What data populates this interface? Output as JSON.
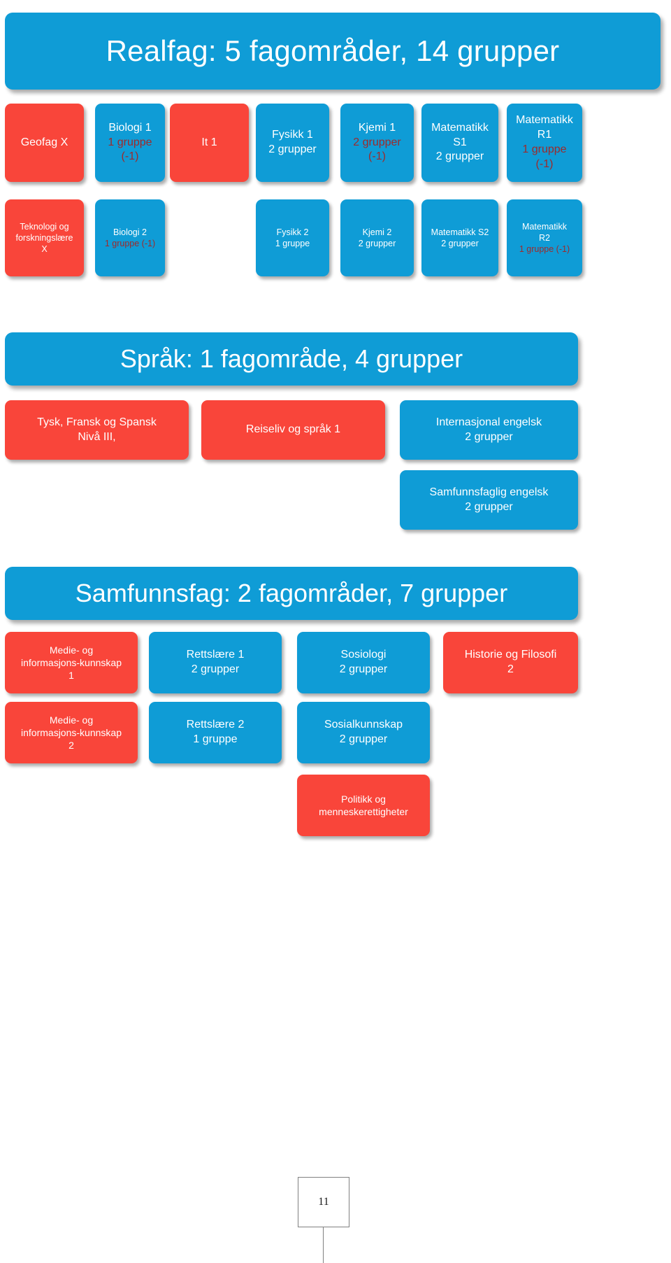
{
  "colors": {
    "blue": "#0f9cd6",
    "red": "#f9453a",
    "dark_red_text": "#9e2a2b",
    "white_text": "#ffffff"
  },
  "sections": {
    "realfag": {
      "banner": "Realfag: 5 fagområder, 14 grupper",
      "row1": [
        {
          "name": "Geofag X",
          "lines": [
            "Geofag X"
          ],
          "color": "red"
        },
        {
          "name": "Biologi 1",
          "lines": [
            "Biologi 1",
            "1 gruppe",
            "(-1)"
          ],
          "color": "blue"
        },
        {
          "name": "It 1",
          "lines": [
            "It 1"
          ],
          "color": "red"
        },
        {
          "name": "Fysikk 1",
          "lines": [
            "Fysikk 1",
            "2 grupper"
          ],
          "color": "blue"
        },
        {
          "name": "Kjemi 1",
          "lines": [
            "Kjemi 1",
            "2 grupper",
            "(-1)"
          ],
          "color": "blue"
        },
        {
          "name": "Matematikk S1",
          "lines": [
            "Matematikk",
            "S1",
            "2 grupper"
          ],
          "color": "blue"
        },
        {
          "name": "Matematikk R1",
          "lines": [
            "Matematikk",
            "R1",
            "1 gruppe",
            "(-1)"
          ],
          "color": "blue"
        }
      ],
      "row2": [
        {
          "name": "Teknologi og forskningslære X",
          "lines": [
            "Teknologi og",
            "forskningslære",
            "X"
          ],
          "color": "red"
        },
        {
          "name": "Biologi 2",
          "lines": [
            "Biologi 2",
            "1 gruppe (-1)"
          ],
          "color": "blue"
        },
        {
          "name": "Fysikk 2",
          "lines": [
            "Fysikk 2",
            "1 gruppe"
          ],
          "color": "blue"
        },
        {
          "name": "Kjemi 2",
          "lines": [
            "Kjemi 2",
            "2 grupper"
          ],
          "color": "blue"
        },
        {
          "name": "Matematikk S2",
          "lines": [
            "Matematikk S2",
            "2 grupper"
          ],
          "color": "blue"
        },
        {
          "name": "Matematikk R2",
          "lines": [
            "Matematikk",
            "R2",
            "1 gruppe (-1)"
          ],
          "color": "blue"
        }
      ]
    },
    "sprak": {
      "banner": "Språk: 1 fagområde, 4 grupper",
      "row1": [
        {
          "name": "Tysk, Fransk og Spansk",
          "lines": [
            "Tysk, Fransk og Spansk",
            "Nivå III,"
          ],
          "color": "red"
        },
        {
          "name": "Reiseliv og språk 1",
          "lines": [
            "Reiseliv  og språk 1"
          ],
          "color": "red"
        },
        {
          "name": "Internasjonal engelsk",
          "lines": [
            "Internasjonal engelsk",
            "2 grupper"
          ],
          "color": "blue"
        }
      ],
      "row2": [
        {
          "name": "Samfunnsfaglig engelsk",
          "lines": [
            "Samfunnsfaglig engelsk",
            "2 grupper"
          ],
          "color": "blue"
        }
      ]
    },
    "samfunnsfag": {
      "banner": "Samfunnsfag: 2 fagområder, 7 grupper",
      "row1": [
        {
          "name": "Medie- og informasjons-kunnskap 1",
          "lines": [
            "Medie- og",
            "informasjons-kunnskap",
            "1"
          ],
          "color": "red"
        },
        {
          "name": "Rettslære 1",
          "lines": [
            "Rettslære 1",
            "2 grupper"
          ],
          "color": "blue"
        },
        {
          "name": "Sosiologi",
          "lines": [
            "Sosiologi",
            "2 grupper"
          ],
          "color": "blue"
        },
        {
          "name": "Historie og Filosofi 2",
          "lines": [
            "Historie og Filosofi",
            "2"
          ],
          "color": "red"
        }
      ],
      "row2": [
        {
          "name": "Medie- og informasjons-kunnskap 2",
          "lines": [
            "Medie- og",
            "informasjons-kunnskap",
            "2"
          ],
          "color": "red"
        },
        {
          "name": "Rettslære 2",
          "lines": [
            "Rettslære 2",
            "1 gruppe"
          ],
          "color": "blue"
        },
        {
          "name": "Sosialkunnskap",
          "lines": [
            "Sosialkunnskap",
            "2 grupper"
          ],
          "color": "blue"
        }
      ],
      "row3": [
        {
          "name": "Politikk og menneskerettigheter",
          "lines": [
            "Politikk og",
            "menneskerettigheter"
          ],
          "color": "red"
        }
      ]
    }
  },
  "footer": {
    "page_number": "11"
  },
  "flat_text": {
    "realfag_banner": "Realfag: 5 fagområder, 14 grupper",
    "sprak_banner": "Språk: 1 fagområde, 4 grupper",
    "samfunnsfag_banner": "Samfunnsfag: 2 fagområder, 7 grupper",
    "geofag_x": "Geofag X",
    "biologi1_l1": "Biologi 1",
    "biologi1_l2": "1 gruppe",
    "biologi1_l3": "(-1)",
    "it1": "It 1",
    "fysikk1_l1": "Fysikk 1",
    "fysikk1_l2": "2 grupper",
    "kjemi1_l1": "Kjemi 1",
    "kjemi1_l2": "2 grupper",
    "kjemi1_l3": "(-1)",
    "mats1_l1": "Matematikk",
    "mats1_l2": "S1",
    "mats1_l3": "2 grupper",
    "matr1_l1": "Matematikk",
    "matr1_l2": "R1",
    "matr1_l3": "1 gruppe",
    "matr1_l4": "(-1)",
    "teknologi_l1": "Teknologi og",
    "teknologi_l2": "forskningslære",
    "teknologi_l3": "X",
    "biologi2_l1": "Biologi 2",
    "biologi2_l2": "1 gruppe (-1)",
    "fysikk2_l1": "Fysikk 2",
    "fysikk2_l2": "1 gruppe",
    "kjemi2_l1": "Kjemi 2",
    "kjemi2_l2": "2 grupper",
    "mats2_l1": "Matematikk S2",
    "mats2_l2": "2 grupper",
    "matr2_l1": "Matematikk",
    "matr2_l2": "R2",
    "matr2_l3": "1 gruppe (-1)",
    "tysk_l1": "Tysk, Fransk og Spansk",
    "tysk_l2": "Nivå III,",
    "reiseliv_l1": "Reiseliv  og språk 1",
    "intengelsk_l1": "Internasjonal engelsk",
    "intengelsk_l2": "2 grupper",
    "samfengelsk_l1": "Samfunnsfaglig engelsk",
    "samfengelsk_l2": "2 grupper",
    "medie1_l1": "Medie- og",
    "medie1_l2": "informasjons-kunnskap",
    "medie1_l3": "1",
    "rettslare1_l1": "Rettslære 1",
    "rettslare1_l2": "2 grupper",
    "sosiologi_l1": "Sosiologi",
    "sosiologi_l2": "2 grupper",
    "historie_l1": "Historie og Filosofi",
    "historie_l2": "2",
    "medie2_l1": "Medie- og",
    "medie2_l2": "informasjons-kunnskap",
    "medie2_l3": "2",
    "rettslare2_l1": "Rettslære 2",
    "rettslare2_l2": "1 gruppe",
    "sosialkunnskap_l1": "Sosialkunnskap",
    "sosialkunnskap_l2": "2 grupper",
    "politikk_l1": "Politikk og",
    "politikk_l2": "menneskerettigheter",
    "page_number": "11"
  }
}
